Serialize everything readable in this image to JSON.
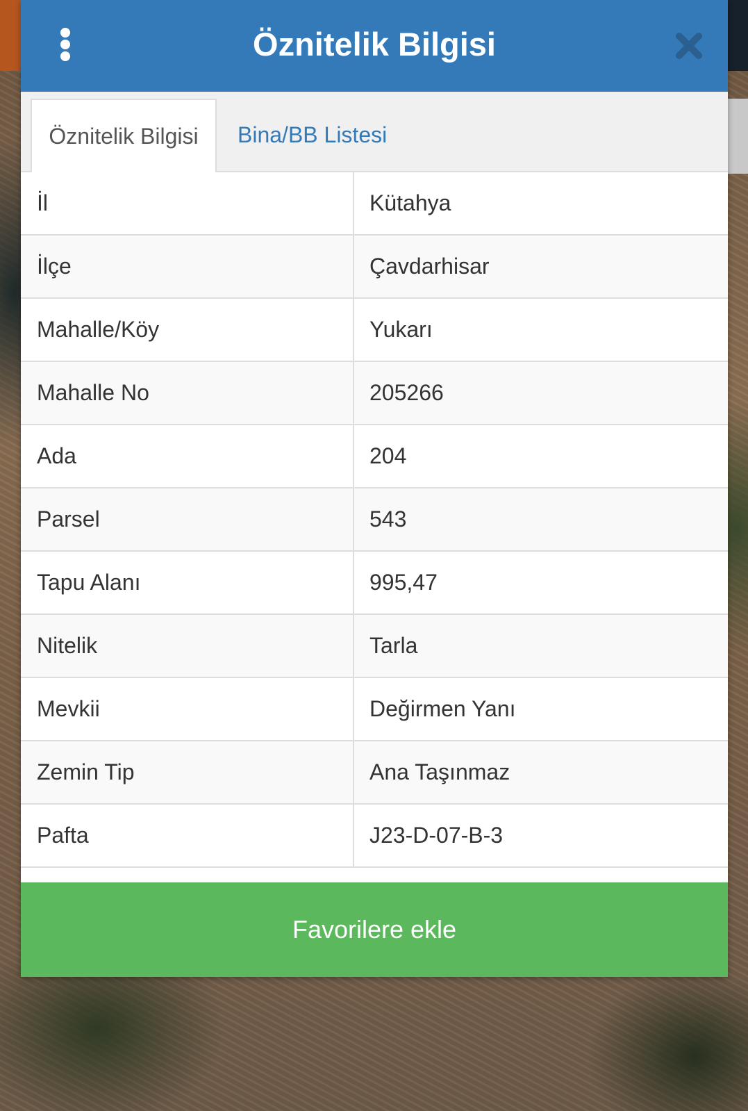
{
  "dialog": {
    "title": "Öznitelik Bilgisi",
    "menu_icon": "vertical-dots-icon",
    "close_icon": "close-icon",
    "header_color": "#347ab8"
  },
  "tabs": [
    {
      "label": "Öznitelik Bilgisi",
      "active": true
    },
    {
      "label": "Bina/BB Listesi",
      "active": false
    }
  ],
  "attributes": [
    {
      "label": "İl",
      "value": "Kütahya"
    },
    {
      "label": "İlçe",
      "value": "Çavdarhisar"
    },
    {
      "label": "Mahalle/Köy",
      "value": "Yukarı"
    },
    {
      "label": "Mahalle No",
      "value": "205266"
    },
    {
      "label": "Ada",
      "value": "204"
    },
    {
      "label": "Parsel",
      "value": "543"
    },
    {
      "label": "Tapu Alanı",
      "value": "995,47"
    },
    {
      "label": "Nitelik",
      "value": "Tarla"
    },
    {
      "label": "Mevkii",
      "value": "Değirmen Yanı"
    },
    {
      "label": "Zemin Tip",
      "value": "Ana Taşınmaz"
    },
    {
      "label": "Pafta",
      "value": "J23-D-07-B-3"
    }
  ],
  "footer": {
    "favorite_label": "Favorilere ekle",
    "button_color": "#5cb85c"
  }
}
